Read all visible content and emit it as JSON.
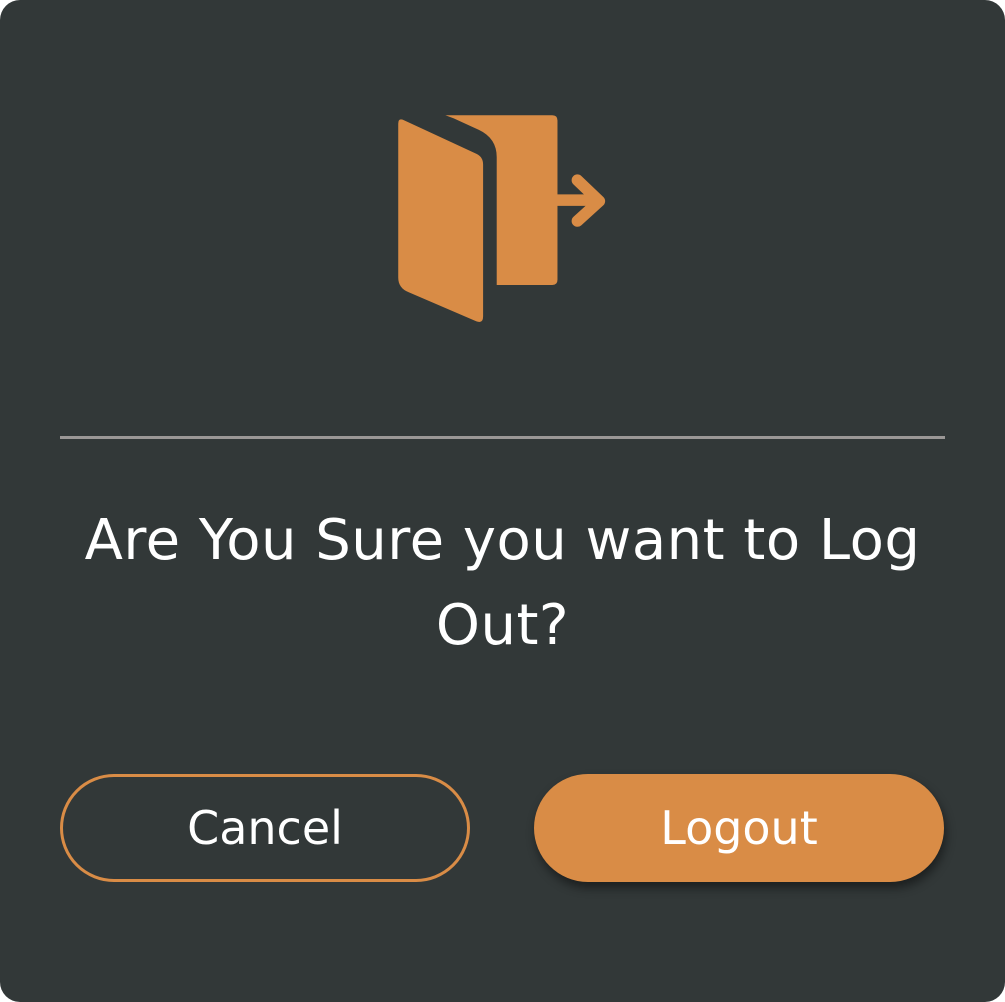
{
  "dialog": {
    "icon": "logout-door-icon",
    "message": "Are You Sure you want to Log Out?",
    "cancel_label": "Cancel",
    "confirm_label": "Logout"
  },
  "colors": {
    "background": "#323838",
    "accent": "#d98c46",
    "divider": "#9a9796",
    "text": "#ffffff"
  }
}
